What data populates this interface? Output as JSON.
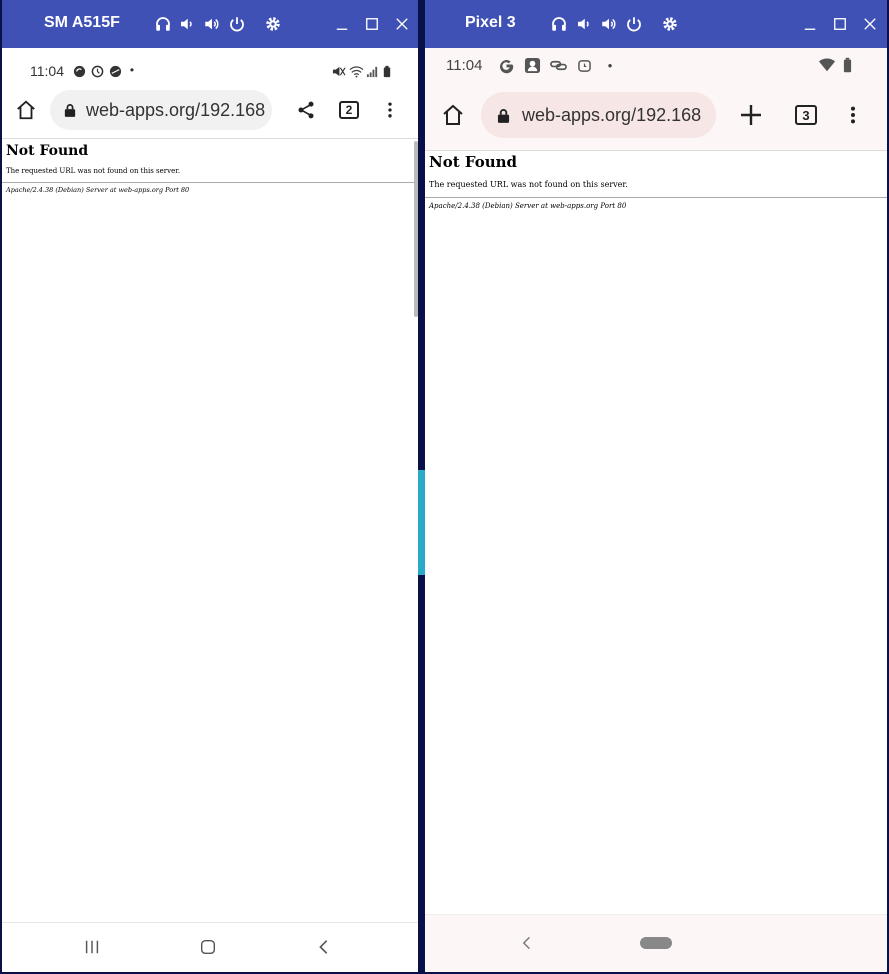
{
  "windows": [
    {
      "device_name": "SM A515F",
      "status": {
        "time": "11:04",
        "dot": "•"
      },
      "url": "web-apps.org/192.168",
      "tab_count": "2",
      "page": {
        "heading": "Not Found",
        "message": "The requested URL was not found on this server.",
        "server_signature": "Apache/2.4.38 (Debian) Server at web-apps.org Port 80"
      }
    },
    {
      "device_name": "Pixel 3",
      "status": {
        "time": "11:04",
        "dot": "•"
      },
      "url": "web-apps.org/192.168",
      "tab_count": "3",
      "page": {
        "heading": "Not Found",
        "message": "The requested URL was not found on this server.",
        "server_signature": "Apache/2.4.38 (Debian) Server at web-apps.org Port 80"
      }
    }
  ],
  "colors": {
    "titlebar": "#3f51b5",
    "desktop": "#0a1048",
    "pixel_chrome": "#fdf6f6"
  }
}
